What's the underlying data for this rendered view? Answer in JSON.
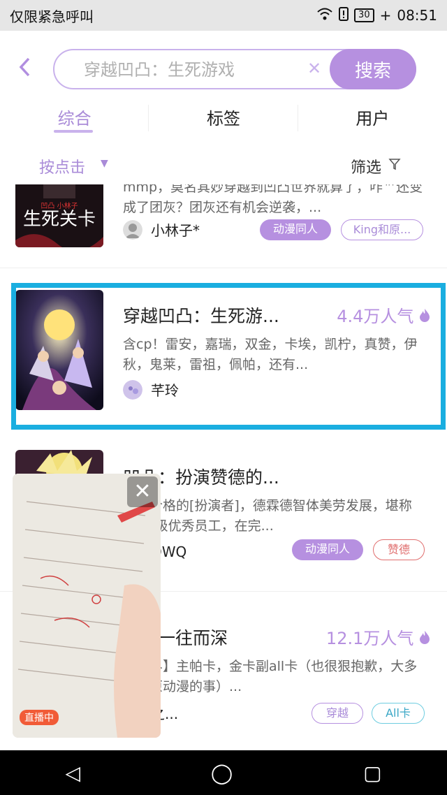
{
  "status_bar": {
    "left_text": "仅限紧急呼叫",
    "battery": "30",
    "time": "08:51"
  },
  "search": {
    "back_icon": "chevron-left-icon",
    "placeholder": "穿越凹凸：生死游戏",
    "clear_icon": "close-icon",
    "button": "搜索"
  },
  "tabs": [
    {
      "label": "综合"
    },
    {
      "label": "标签"
    },
    {
      "label": "用户"
    }
  ],
  "filter_bar": {
    "sort_label": "按点击",
    "filter_label": "筛选"
  },
  "results": [
    {
      "desc": "mmp，莫名其妙穿越到凹凸世界就算了，咋™还变成了团灰？团灰还有机会逆袭，...",
      "author": "小林子*",
      "tags": [
        "动漫同人",
        "King和原..."
      ]
    },
    {
      "title": "穿越凹凸：生死游...",
      "popularity": "4.4万人气",
      "desc": "含cp！雷安，嘉瑞，双金，卡埃，凯柠，真赞，伊秋，鬼莱，雷祖，佩帕，还有...",
      "author": "芊玲"
    },
    {
      "title": "凹凸：扮演赞德的...",
      "desc": "一名合格的[扮演者]，德霖德智体美劳发展，堪称sss+级优秀员工，在完...",
      "author": "玄谙QWQ",
      "tags": [
        "动漫同人",
        "赞德"
      ]
    },
    {
      "title": "卡：一往而深",
      "popularity": "12.1万人气",
      "desc": "越异界】主帕卡，金卡副all卡（也很狠抱歉，大多都是原动漫的事）...",
      "author": "生死之...",
      "tags": [
        "穿越",
        "All卡"
      ]
    }
  ],
  "floating_video": {
    "live_label": "直播中",
    "close_icon": "close-icon"
  },
  "nav_bar": {
    "back": "◁",
    "home": "◯",
    "recent": "▢"
  },
  "colors": {
    "accent": "#b690e0",
    "highlight": "#1aaee0",
    "live": "#f15b37"
  }
}
